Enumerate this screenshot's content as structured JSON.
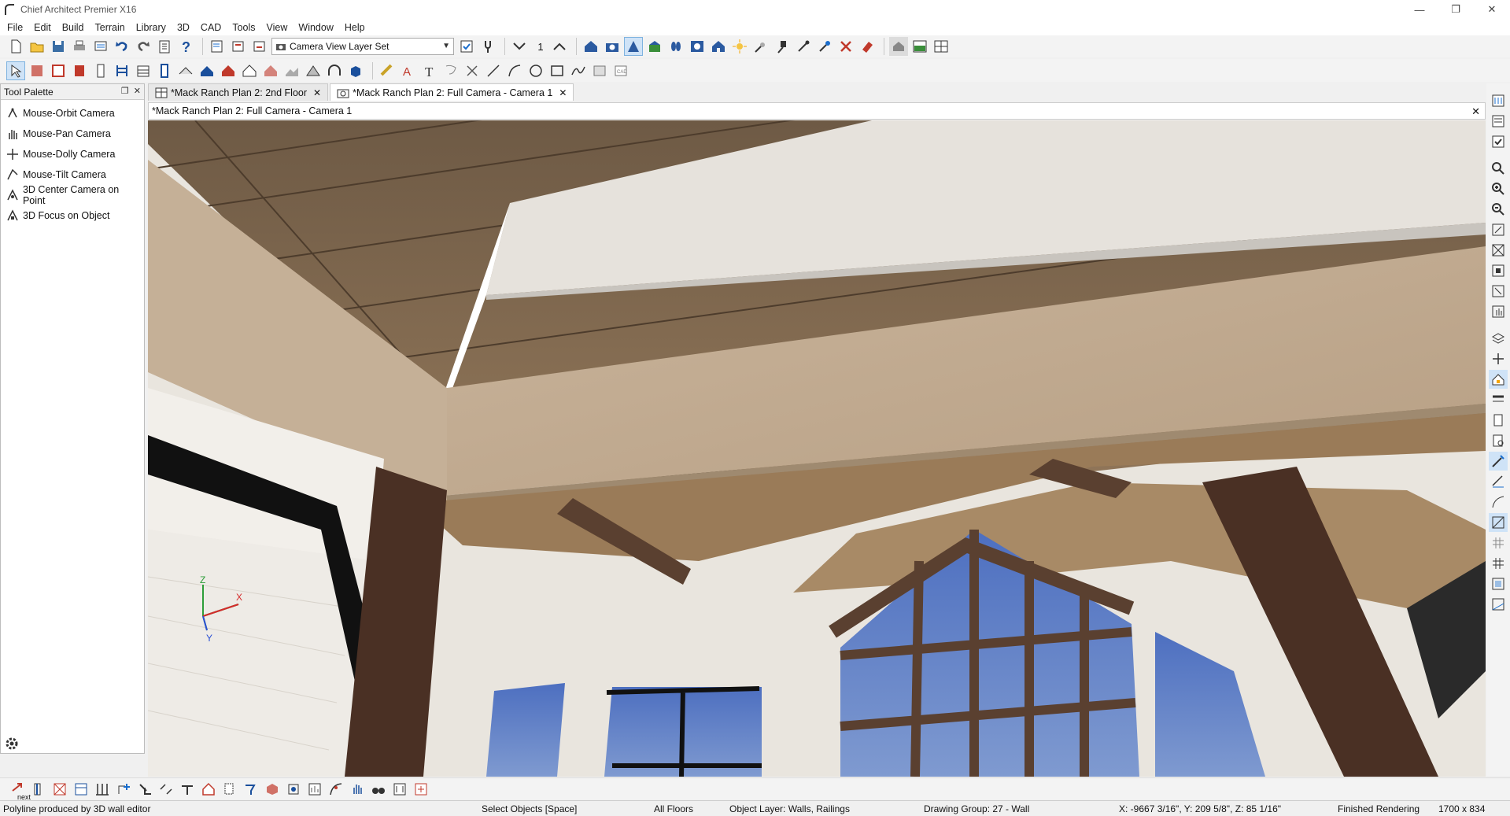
{
  "window": {
    "title": "Chief Architect Premier X16",
    "minimize_icon": "minimize-icon",
    "maximize_icon": "restore-icon",
    "close_icon": "close-icon"
  },
  "menu": [
    "File",
    "Edit",
    "Build",
    "Terrain",
    "Library",
    "3D",
    "CAD",
    "Tools",
    "View",
    "Window",
    "Help"
  ],
  "toolbar": {
    "layer_set_value": "Camera View Layer Set",
    "floor_number": "1"
  },
  "tool_palette": {
    "title": "Tool Palette",
    "items": [
      {
        "label": "Mouse-Orbit Camera",
        "icon": "orbit-camera-icon"
      },
      {
        "label": "Mouse-Pan Camera",
        "icon": "pan-hand-icon"
      },
      {
        "label": "Mouse-Dolly Camera",
        "icon": "dolly-camera-icon"
      },
      {
        "label": "Mouse-Tilt Camera",
        "icon": "tilt-camera-icon"
      },
      {
        "label": "3D Center Camera on Point",
        "icon": "center-camera-icon"
      },
      {
        "label": "3D Focus on Object",
        "icon": "focus-object-icon"
      }
    ]
  },
  "tabs": [
    {
      "label": "*Mack Ranch Plan 2: 2nd Floor",
      "icon": "plan-view-icon",
      "active": false
    },
    {
      "label": "*Mack Ranch Plan 2: Full Camera - Camera 1",
      "icon": "camera-icon",
      "active": true
    }
  ],
  "view_header": "*Mack Ranch Plan 2: Full Camera - Camera 1",
  "axis_labels": {
    "x": "X",
    "z": "Z",
    "y": "Y"
  },
  "bottom_toolbar": {
    "next_label": "next"
  },
  "status": {
    "message": "Polyline produced by 3D wall editor",
    "mode": "Select Objects [Space]",
    "floors": "All Floors",
    "object_layer": "Object Layer: Walls,  Railings",
    "drawing_group": "Drawing Group: 27 - Wall",
    "coords": "X: -9667 3/16\", Y: 209 5/8\", Z: 85 1/16\"",
    "render_state": "Finished Rendering",
    "view_size": "1700 x 834"
  }
}
